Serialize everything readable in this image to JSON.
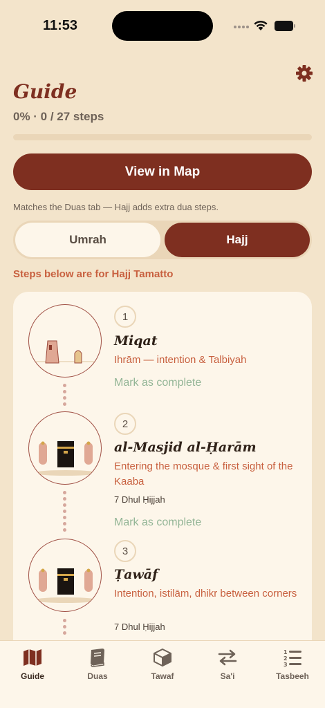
{
  "status": {
    "time": "11:53"
  },
  "header": {
    "title": "Guide",
    "progress_text": "0% · 0 / 27 steps",
    "progress_fraction": 0
  },
  "map_button": {
    "label": "View in Map"
  },
  "note": "Matches the Duas tab — Hajj adds extra dua steps.",
  "segmented": {
    "options": [
      "Umrah",
      "Hajj"
    ],
    "selected": "Hajj"
  },
  "hint": "Steps below are for Hajj Tamatto",
  "steps": [
    {
      "number": "1",
      "name": "Miqat",
      "description": "Ihrām — intention & Talbiyah",
      "date": "",
      "action": "Mark as complete"
    },
    {
      "number": "2",
      "name": "al-Masjid al-Ḥarām",
      "description": "Entering the mosque & first sight of the Kaaba",
      "date": "7 Dhul Ḥijjah",
      "action": "Mark as complete"
    },
    {
      "number": "3",
      "name": "Ṭawāf",
      "description": "Intention, istilām, dhikr between corners",
      "date": "7 Dhul Ḥijjah",
      "action": ""
    }
  ],
  "tabs": [
    {
      "label": "Guide",
      "icon": "map-icon",
      "active": true
    },
    {
      "label": "Duas",
      "icon": "book-icon",
      "active": false
    },
    {
      "label": "Tawaf",
      "icon": "cube-icon",
      "active": false
    },
    {
      "label": "Sa'i",
      "icon": "arrows-icon",
      "active": false
    },
    {
      "label": "Tasbeeh",
      "icon": "list-numbered-icon",
      "active": false
    }
  ],
  "colors": {
    "accent": "#7e2f20",
    "background": "#f3e4cb",
    "card": "#fdf6ea",
    "hint": "#c8603f",
    "complete": "#93b596"
  }
}
